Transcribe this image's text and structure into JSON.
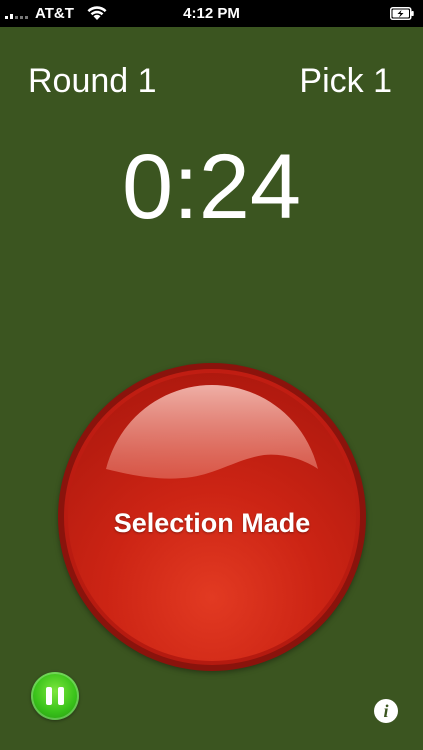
{
  "status_bar": {
    "carrier": "AT&T",
    "time": "4:12 PM",
    "signal_bars_active": 2,
    "signal_bars_total": 5,
    "wifi_icon": "wifi-icon",
    "battery_icon": "battery-charging-icon"
  },
  "header": {
    "round": "Round 1",
    "pick": "Pick 1"
  },
  "timer": {
    "value": "0:24"
  },
  "main_button": {
    "label": "Selection Made",
    "icon": "big-red-button"
  },
  "controls": {
    "pause_icon": "pause-icon",
    "info_glyph": "i",
    "info_icon": "info-icon"
  },
  "colors": {
    "background": "#3b5520",
    "button_red": "#cc2414",
    "pause_green": "#39c21a",
    "text": "#ffffff"
  }
}
